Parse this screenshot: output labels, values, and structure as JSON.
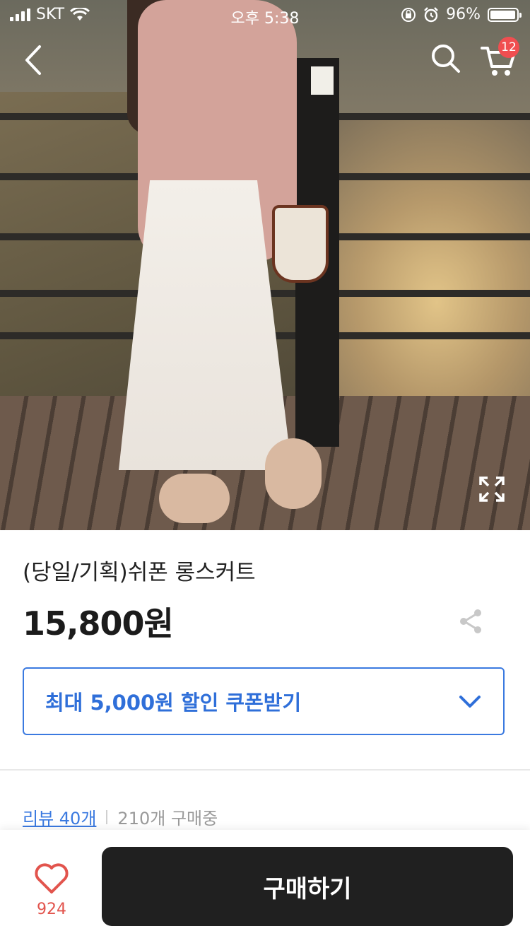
{
  "status_bar": {
    "carrier": "SKT",
    "time": "오후 5:38",
    "battery": "96%"
  },
  "top_nav": {
    "cart_count": "12",
    "icons": [
      "chevron-left-icon",
      "search-icon",
      "cart-icon",
      "expand-icon"
    ]
  },
  "product": {
    "title": "(당일/기획)쉬폰 롱스커트",
    "price": "15,800원"
  },
  "coupon": {
    "label": "최대 5,000원 할인 쿠폰받기"
  },
  "reviews": {
    "review_link": "리뷰 40개",
    "buyers": "210개 구매중"
  },
  "bottom_bar": {
    "like_count": "924",
    "buy_label": "구매하기"
  },
  "colors": {
    "accent_blue": "#3b7ae0",
    "like_red": "#e2544d",
    "badge_red": "#f04e50",
    "buy_button": "#202020"
  }
}
